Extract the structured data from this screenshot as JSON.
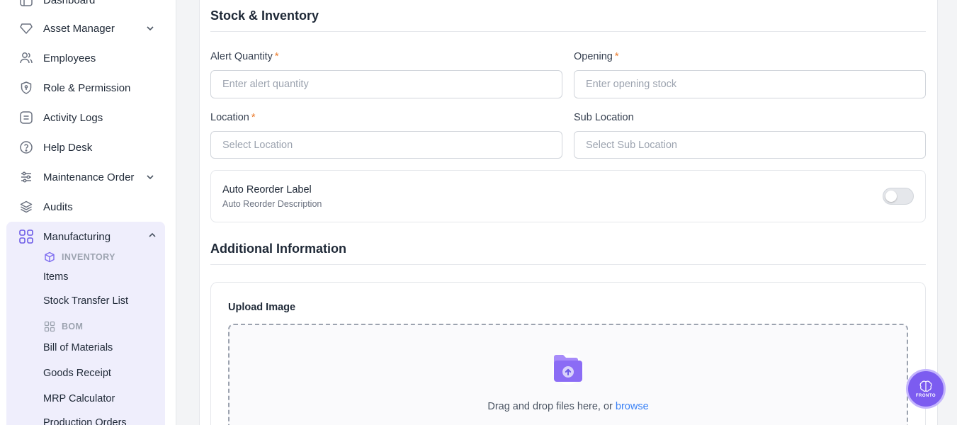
{
  "sidebar": {
    "items": [
      {
        "label": "Dashboard"
      },
      {
        "label": "Asset Manager"
      },
      {
        "label": "Employees"
      },
      {
        "label": "Role & Permission"
      },
      {
        "label": "Activity Logs"
      },
      {
        "label": "Help Desk"
      },
      {
        "label": "Maintenance Order"
      },
      {
        "label": "Audits"
      }
    ],
    "manufacturing": {
      "label": "Manufacturing",
      "groups": [
        {
          "label": "INVENTORY",
          "items": [
            "Items",
            "Stock Transfer List"
          ]
        },
        {
          "label": "BOM",
          "items": [
            "Bill of Materials",
            "Goods Receipt",
            "MRP Calculator",
            "Production Orders"
          ]
        }
      ]
    }
  },
  "form": {
    "stock_section_title": "Stock & Inventory",
    "alert_quantity": {
      "label": "Alert Quantity",
      "required": "*",
      "placeholder": "Enter alert quantity",
      "value": ""
    },
    "opening": {
      "label": "Opening",
      "required": "*",
      "placeholder": "Enter opening stock",
      "value": ""
    },
    "location": {
      "label": "Location",
      "required": "*",
      "placeholder": "Select Location",
      "value": ""
    },
    "sub_location": {
      "label": "Sub Location",
      "placeholder": "Select Sub Location",
      "value": ""
    },
    "auto_reorder": {
      "title": "Auto Reorder Label",
      "description": "Auto Reorder Description",
      "enabled": false
    },
    "additional_section_title": "Additional Information",
    "upload": {
      "label": "Upload Image",
      "drop_text": "Drag and drop files here, or ",
      "browse_label": "browse"
    }
  },
  "fab": {
    "label": "FRONTO"
  },
  "colors": {
    "accent": "#7c5cf0",
    "link": "#3b82f6",
    "required": "#ea7a2b",
    "sidebar_active_bg": "#efeefc"
  }
}
